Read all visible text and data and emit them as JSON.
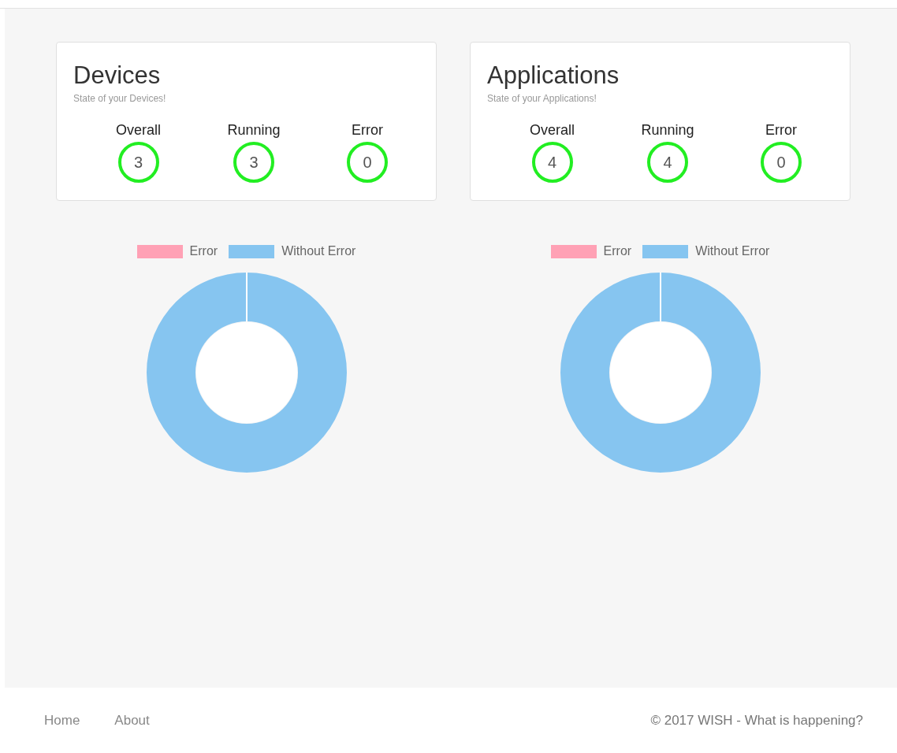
{
  "panels": [
    {
      "title": "Devices",
      "subtitle": "State of your Devices!",
      "stats": [
        {
          "label": "Overall",
          "value": "3"
        },
        {
          "label": "Running",
          "value": "3"
        },
        {
          "label": "Error",
          "value": "0"
        }
      ],
      "chart_data": {
        "type": "donut",
        "categories": [
          "Error",
          "Without Error"
        ],
        "values": [
          0,
          100
        ],
        "colors": [
          "#ffa1b5",
          "#86c5f0"
        ]
      }
    },
    {
      "title": "Applications",
      "subtitle": "State of your Applications!",
      "stats": [
        {
          "label": "Overall",
          "value": "4"
        },
        {
          "label": "Running",
          "value": "4"
        },
        {
          "label": "Error",
          "value": "0"
        }
      ],
      "chart_data": {
        "type": "donut",
        "categories": [
          "Error",
          "Without Error"
        ],
        "values": [
          0,
          100
        ],
        "colors": [
          "#ffa1b5",
          "#86c5f0"
        ]
      }
    }
  ],
  "footer": {
    "links": [
      "Home",
      "About"
    ],
    "copyright": "© 2017 WISH - What is happening?"
  }
}
